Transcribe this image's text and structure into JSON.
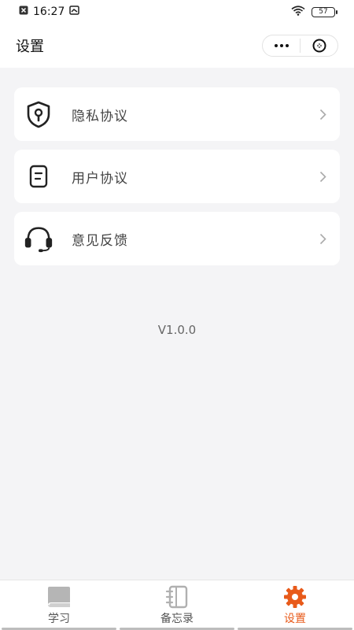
{
  "status_bar": {
    "time": "16:27",
    "battery": "57",
    "icons": [
      "notification-close-icon",
      "screenshot-icon",
      "wifi-icon",
      "battery-icon"
    ]
  },
  "header": {
    "title": "设置",
    "more_icon": "more-dots-icon",
    "close_icon": "close-circle-icon"
  },
  "menu": {
    "items": [
      {
        "label": "隐私协议",
        "icon": "privacy-shield-icon"
      },
      {
        "label": "用户协议",
        "icon": "agreement-document-icon"
      },
      {
        "label": "意见反馈",
        "icon": "headset-icon"
      }
    ]
  },
  "version": "V1.0.0",
  "tabbar": {
    "accent_color": "#e85a1a",
    "tabs": [
      {
        "label": "学习",
        "icon": "book-icon",
        "active": false
      },
      {
        "label": "备忘录",
        "icon": "notebook-icon",
        "active": false
      },
      {
        "label": "设置",
        "icon": "gear-icon",
        "active": true
      }
    ]
  }
}
